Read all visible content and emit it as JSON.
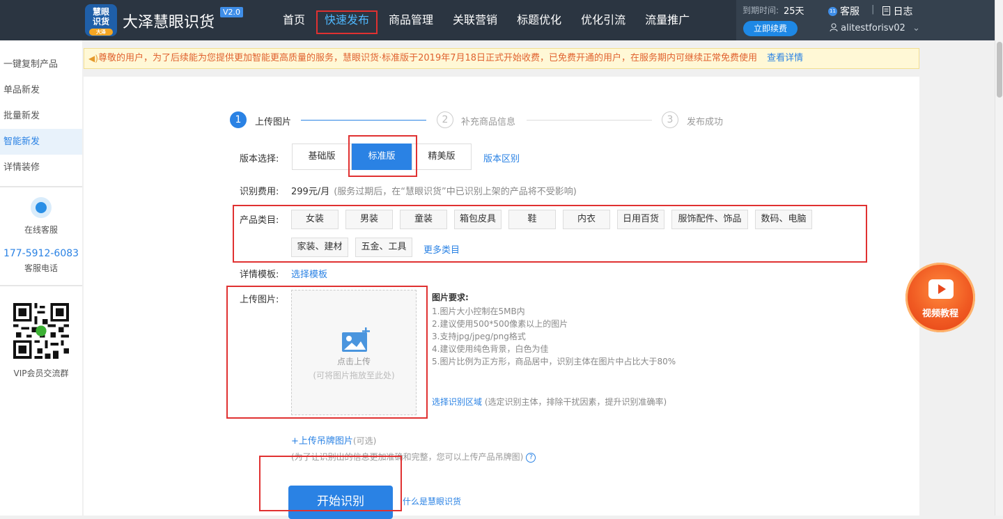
{
  "header": {
    "logo_text": "慧眼识货",
    "logo_sub": "大泽",
    "app_name": "大泽慧眼识货",
    "version": "V2.0",
    "nav": [
      "首页",
      "快速发布",
      "商品管理",
      "关联营销",
      "标题优化",
      "优化引流",
      "流量推广"
    ],
    "active_nav": "快速发布",
    "expire_label": "到期时间:",
    "expire_value": "25天",
    "renew_button": "立即续费",
    "service": "客服",
    "service_badge": "11",
    "log": "日志",
    "user": "alitestforisv02"
  },
  "sidebar": {
    "items": [
      "一键复制产品",
      "单品新发",
      "批量新发",
      "智能新发",
      "详情装修"
    ],
    "active_item": "智能新发",
    "online_service": "在线客服",
    "phone": "177-5912-6083",
    "phone_label": "客服电话",
    "qr_label": "VIP会员交流群"
  },
  "notice": {
    "text": "尊敬的用户，为了后续能为您提供更加智能更高质量的服务，慧眼识货·标准版于2019年7月18日正式开始收费，已免费开通的用户，在服务期内可继续正常免费使用",
    "link": "查看详情"
  },
  "steps": [
    {
      "num": "1",
      "label": "上传图片"
    },
    {
      "num": "2",
      "label": "补充商品信息"
    },
    {
      "num": "3",
      "label": "发布成功"
    }
  ],
  "form": {
    "version_label": "版本选择:",
    "versions": [
      "基础版",
      "标准版",
      "精美版"
    ],
    "selected_version": "标准版",
    "version_diff_link": "版本区别",
    "fee_label": "识别费用:",
    "fee_value": "299元/月",
    "fee_note": "(服务过期后，在“慧眼识货”中已识别上架的产品将不受影响)",
    "category_label": "产品类目:",
    "categories": [
      "女装",
      "男装",
      "童装",
      "箱包皮具",
      "鞋",
      "内衣",
      "日用百货",
      "服饰配件、饰品",
      "数码、电脑",
      "家装、建材",
      "五金、工具"
    ],
    "more_categories": "更多类目",
    "template_label": "详情模板:",
    "template_link": "选择模板",
    "upload_label": "上传图片:",
    "upload_click": "点击上传",
    "upload_drag": "(可将图片拖放至此处)",
    "req_title": "图片要求:",
    "requirements": [
      "1.图片大小控制在5MB内",
      "2.建议使用500*500像素以上的图片",
      "3.支持jpg/jpeg/png格式",
      "4.建议使用纯色背景，白色为佳",
      "5.图片比例为正方形，商品居中，识别主体在图片中占比大于80%"
    ],
    "region_link": "选择识别区域",
    "region_note": "(选定识别主体，排除干扰因素，提升识别准确率)",
    "tag_upload": "上传吊牌图片",
    "tag_optional": "(可选)",
    "tag_note": "(为了让识别出的信息更加准确和完整，您可以上传产品吊牌图)",
    "help": "?",
    "start_button": "开始识别",
    "what_link": "什么是慧眼识货"
  },
  "video": {
    "label": "视频教程"
  }
}
